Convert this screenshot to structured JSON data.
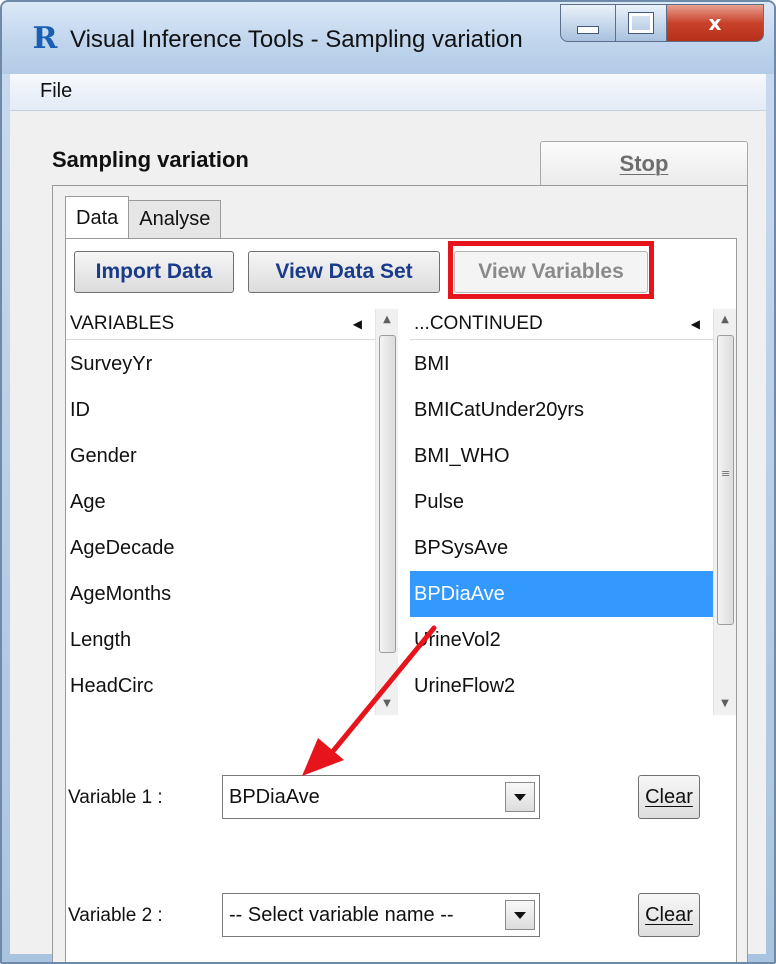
{
  "window": {
    "title": "Visual Inference Tools - Sampling variation",
    "app_icon": "R",
    "close_glyph": "x"
  },
  "menu": {
    "file": "File"
  },
  "panel": {
    "heading": "Sampling variation",
    "stop_label": "Stop",
    "tabs": [
      {
        "label": "Data"
      },
      {
        "label": "Analyse"
      }
    ]
  },
  "toolbar": {
    "import_label": "Import Data",
    "view_data_label": "View Data Set",
    "view_variables_label": "View Variables"
  },
  "variables_list": {
    "header": "VARIABLES",
    "items": [
      "SurveyYr",
      "ID",
      "Gender",
      "Age",
      "AgeDecade",
      "AgeMonths",
      "Length",
      "HeadCirc"
    ]
  },
  "continued_list": {
    "header": "...CONTINUED",
    "items": [
      "BMI",
      "BMICatUnder20yrs",
      "BMI_WHO",
      "Pulse",
      "BPSysAve",
      "BPDiaAve",
      "UrineVol2",
      "UrineFlow2"
    ],
    "selected": "BPDiaAve"
  },
  "fields": {
    "variable1_label": "Variable 1 :",
    "variable1_value": "BPDiaAve",
    "variable2_label": "Variable 2 :",
    "variable2_value": "-- Select variable name --",
    "clear_label": "Clear"
  },
  "colors": {
    "selection": "#3399ff",
    "highlight": "#e8141c",
    "button_text": "#1a3b8a"
  }
}
